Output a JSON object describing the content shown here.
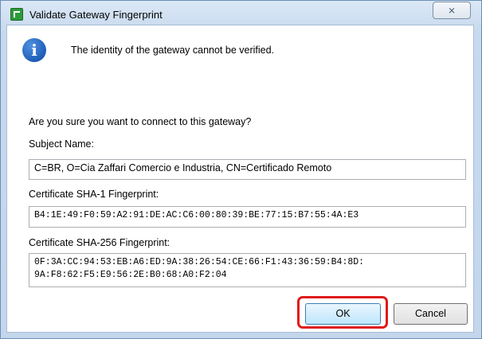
{
  "window": {
    "title": "Validate Gateway Fingerprint",
    "close_glyph": "⨯"
  },
  "message": {
    "icon": "info-icon",
    "icon_glyph": "i",
    "text": "The identity of the gateway cannot be verified."
  },
  "question": "Are you sure you want to connect to this gateway?",
  "fields": {
    "subject": {
      "label": "Subject Name:",
      "value": "C=BR, O=Cia Zaffari Comercio e Industria, CN=Certificado Remoto"
    },
    "sha1": {
      "label": "Certificate SHA-1 Fingerprint:",
      "value": "B4:1E:49:F0:59:A2:91:DE:AC:C6:00:80:39:BE:77:15:B7:55:4A:E3"
    },
    "sha256": {
      "label": "Certificate SHA-256 Fingerprint:",
      "line1": "0F:3A:CC:94:53:EB:A6:ED:9A:38:26:54:CE:66:F1:43:36:59:B4:8D:",
      "line2": "9A:F8:62:F5:E9:56:2E:B0:68:A0:F2:04"
    }
  },
  "buttons": {
    "ok": "OK",
    "cancel": "Cancel"
  },
  "colors": {
    "highlight": "#e01b1b",
    "info_icon": "#1e5fb8",
    "app_icon": "#2e9a3c"
  }
}
